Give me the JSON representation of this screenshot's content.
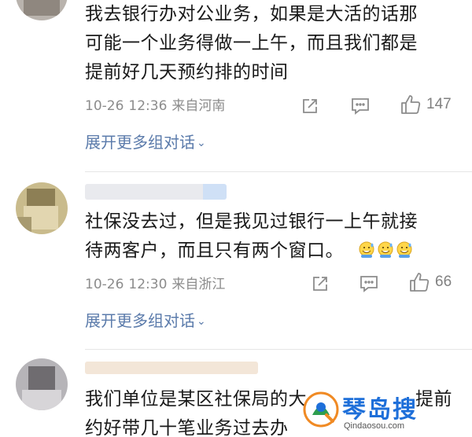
{
  "comments": [
    {
      "text_lines": [
        "我去银行办对公业务，如果是大活的话那",
        "可能一个业务得做一上午，而且我们都是",
        "提前好几天预约排的时间"
      ],
      "date": "10-26",
      "time": "12:36",
      "location": "来自河南",
      "like_count": "147",
      "expand_label": "展开更多组对话"
    },
    {
      "text_lines": [
        "社保没去过，但是我见过银行一上午就接",
        "待两客户，而且只有两个窗口。"
      ],
      "emoji_count": 3,
      "date": "10-26",
      "time": "12:30",
      "location": "来自浙江",
      "like_count": "66",
      "expand_label": "展开更多组对话"
    },
    {
      "text_lines": [
        "我们单位是某区社保局的大",
        "约好带几十笔业务过去办"
      ],
      "text_tail": "提前"
    }
  ],
  "icons": {
    "repost": "repost-icon",
    "comment": "comment-icon",
    "like": "like-icon",
    "expand": "chevron-down-icon",
    "emoji": "sweat-smile-emoji-icon"
  },
  "colors": {
    "link": "#5b7bab",
    "meta": "#8c8c8c",
    "watermark": "#1e6fd9"
  },
  "watermark": {
    "title": "琴岛搜",
    "url": "Qindaosou.com"
  }
}
